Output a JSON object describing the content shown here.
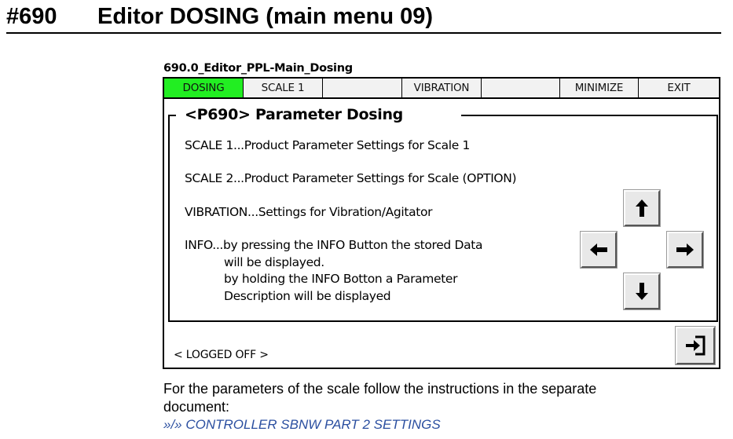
{
  "doc": {
    "number": "#690",
    "title": "Editor DOSING (main menu 09)",
    "caption": "690.0_Editor_PPL-Main_Dosing"
  },
  "tabs": [
    {
      "label": "DOSING"
    },
    {
      "label": "SCALE 1"
    },
    {
      "label": ""
    },
    {
      "label": "VIBRATION"
    },
    {
      "label": ""
    },
    {
      "label": "MINIMIZE"
    },
    {
      "label": "EXIT"
    }
  ],
  "panel": {
    "title": "<P690> Parameter Dosing",
    "lines": [
      "SCALE 1...Product Parameter Settings for Scale 1",
      "SCALE 2...Product Parameter Settings for Scale  (OPTION)",
      "VIBRATION...Settings for Vibration/Agitator",
      "INFO...by pressing the INFO Button the stored Data",
      "will be displayed.",
      "by holding the INFO Botton a Parameter",
      "Description will be displayed"
    ]
  },
  "status": "< LOGGED OFF >",
  "icons": {
    "up": "arrow-up-icon",
    "left": "arrow-left-icon",
    "right": "arrow-right-icon",
    "down": "arrow-down-icon",
    "enter": "enter-icon"
  },
  "colors": {
    "active_tab": "#22ee22",
    "link": "#2b4fa0"
  },
  "footer": {
    "text_line1": "For the parameters of the scale follow the instructions in the separate",
    "text_line2": "document:",
    "link": "»/» CONTROLLER SBNW PART 2 SETTINGS"
  }
}
